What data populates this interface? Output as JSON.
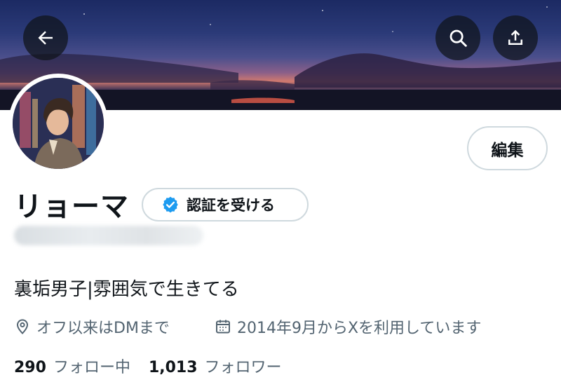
{
  "profile": {
    "display_name": "リョーマ",
    "verify_label": "認証を受ける",
    "edit_label": "編集",
    "bio": "裏垢男子|雰囲気で生きてる",
    "location": "オフ以来はDMまで",
    "joined": "2014年9月からXを利用しています"
  },
  "stats": {
    "following_count": "290",
    "following_label": "フォロー中",
    "followers_count": "1,013",
    "followers_label": "フォロワー"
  },
  "icons": {
    "back": "arrow-left-icon",
    "search": "search-icon",
    "share": "share-icon",
    "verified": "verified-badge-icon",
    "location": "location-pin-icon",
    "calendar": "calendar-icon"
  },
  "colors": {
    "accent": "#1d9bf0",
    "text_primary": "#0f1419",
    "text_secondary": "#536471",
    "border": "#cfd9de"
  }
}
